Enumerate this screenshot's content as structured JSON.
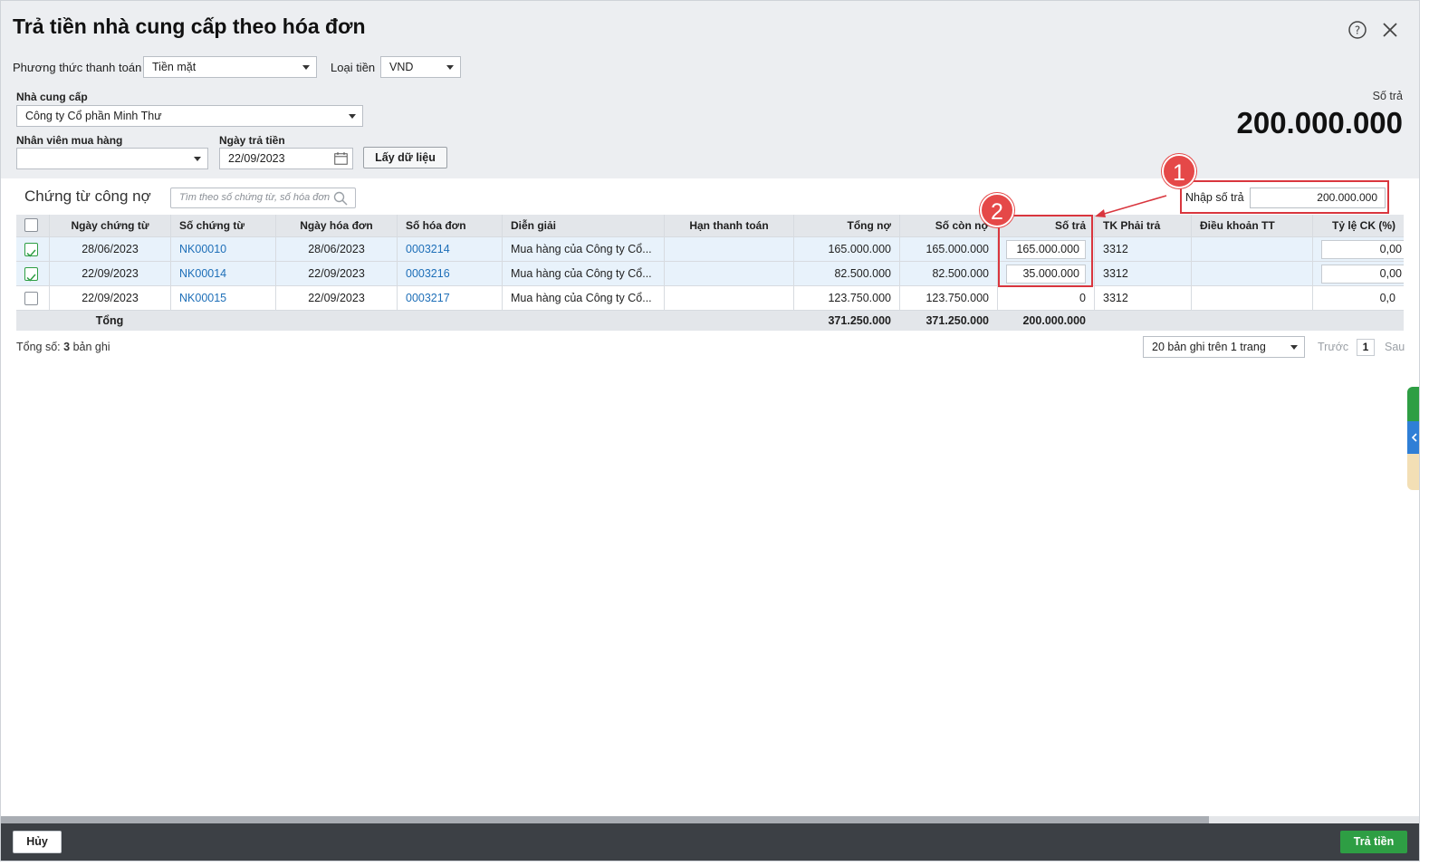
{
  "title": "Trả tiền nhà cung cấp theo hóa đơn",
  "header": {
    "payment_method_label": "Phương thức thanh toán",
    "payment_method_value": "Tiền mặt",
    "currency_label": "Loại tiền",
    "currency_value": "VND",
    "supplier_label": "Nhà cung cấp",
    "supplier_value": "Công ty Cổ phần Minh Thư",
    "employee_label": "Nhân viên mua hàng",
    "employee_value": "",
    "pay_date_label": "Ngày trả tiền",
    "pay_date_value": "22/09/2023",
    "fetch_button": "Lấy dữ liệu",
    "amount_label": "Số trả",
    "amount_value": "200.000.000"
  },
  "section": {
    "title": "Chứng từ công nợ",
    "search_placeholder": "Tìm theo số chứng từ, số hóa đơn",
    "enter_amount_label": "Nhập số trả",
    "enter_amount_value": "200.000.000"
  },
  "annotations": {
    "badge1": "1",
    "badge2": "2"
  },
  "table": {
    "columns": [
      "Ngày chứng từ",
      "Số chứng từ",
      "Ngày hóa đơn",
      "Số hóa đơn",
      "Diễn giải",
      "Hạn thanh toán",
      "Tổng nợ",
      "Số còn nợ",
      "Số trả",
      "TK Phải trả",
      "Điều khoản TT",
      "Tỷ lệ CK (%)"
    ],
    "rows": [
      {
        "checked": true,
        "doc_date": "28/06/2023",
        "doc_no": "NK00010",
        "inv_date": "28/06/2023",
        "inv_no": "0003214",
        "desc": "Mua hàng của Công ty Cổ...",
        "due": "",
        "total": "165.000.000",
        "remaining": "165.000.000",
        "pay": "165.000.000",
        "account": "3312",
        "terms": "",
        "discount": "0,00"
      },
      {
        "checked": true,
        "doc_date": "22/09/2023",
        "doc_no": "NK00014",
        "inv_date": "22/09/2023",
        "inv_no": "0003216",
        "desc": "Mua hàng của Công ty Cổ...",
        "due": "",
        "total": "82.500.000",
        "remaining": "82.500.000",
        "pay": "35.000.000",
        "account": "3312",
        "terms": "",
        "discount": "0,00"
      },
      {
        "checked": false,
        "doc_date": "22/09/2023",
        "doc_no": "NK00015",
        "inv_date": "22/09/2023",
        "inv_no": "0003217",
        "desc": "Mua hàng của Công ty Cổ...",
        "due": "",
        "total": "123.750.000",
        "remaining": "123.750.000",
        "pay": "0",
        "account": "3312",
        "terms": "",
        "discount": "0,0"
      }
    ],
    "totals": {
      "label": "Tổng",
      "total": "371.250.000",
      "remaining": "371.250.000",
      "pay": "200.000.000"
    }
  },
  "footer": {
    "count_prefix": "Tổng số:",
    "count_value": "3",
    "count_suffix": "bản ghi",
    "page_size": "20 bản ghi trên 1 trang",
    "prev": "Trước",
    "page": "1",
    "next": "Sau"
  },
  "actions": {
    "cancel": "Hủy",
    "pay": "Trả tiền"
  },
  "colors": {
    "accent_green": "#2e9e44",
    "highlight_red": "#d9363e",
    "link_blue": "#1e6fb8",
    "bottom_bar": "#3c4045"
  }
}
